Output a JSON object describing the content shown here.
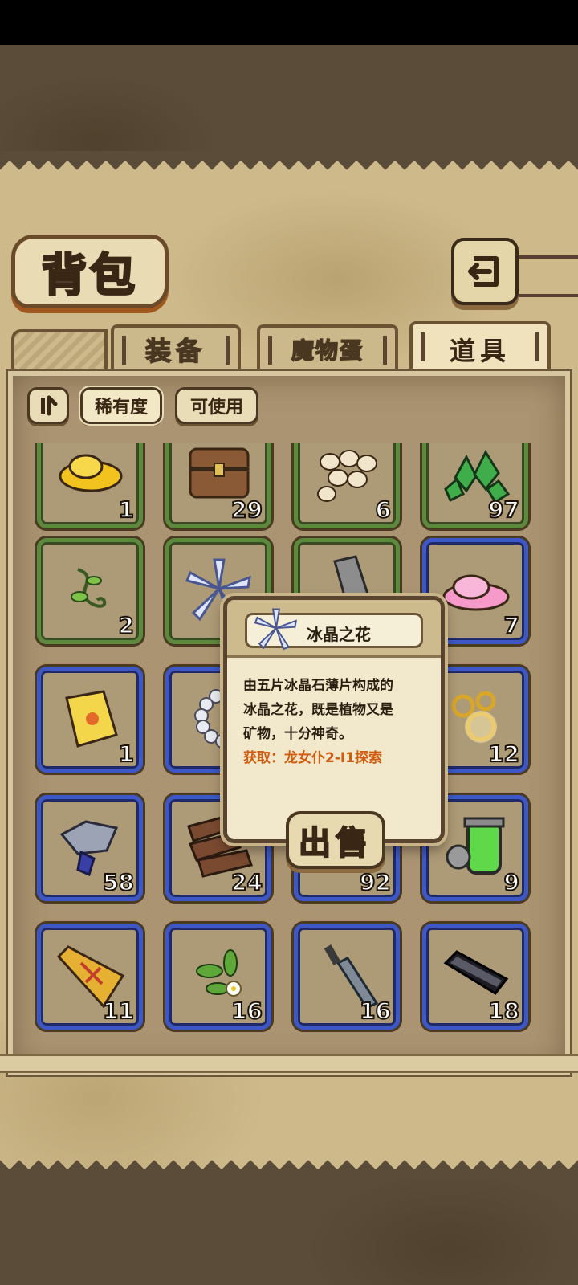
{
  "header": {
    "title": "背包",
    "back_icon": "back-arrow-icon"
  },
  "tabs": [
    {
      "label": "装备",
      "active": false
    },
    {
      "label": "魔物蛋",
      "active": false
    },
    {
      "label": "道具",
      "active": true
    }
  ],
  "filters": {
    "sort_icon": "sort-toggle-icon",
    "rarity_label": "稀有度",
    "usable_label": "可使用"
  },
  "items": [
    {
      "icon": "gold-slime-icon",
      "qty": "1",
      "rarity": "green"
    },
    {
      "icon": "treasure-chest-icon",
      "qty": "29",
      "rarity": "green"
    },
    {
      "icon": "eggs-pile-icon",
      "qty": "6",
      "rarity": "green"
    },
    {
      "icon": "green-crystals-icon",
      "qty": "97",
      "rarity": "green"
    },
    {
      "icon": "vine-icon",
      "qty": "2",
      "rarity": "green"
    },
    {
      "icon": "ice-crystal-flower-icon",
      "qty": "",
      "rarity": "green"
    },
    {
      "icon": "stone-shard-icon",
      "qty": "",
      "rarity": "green"
    },
    {
      "icon": "pink-slime-icon",
      "qty": "7",
      "rarity": "blue"
    },
    {
      "icon": "golden-scroll-icon",
      "qty": "1",
      "rarity": "blue"
    },
    {
      "icon": "pearl-necklace-icon",
      "qty": "",
      "rarity": "blue"
    },
    {
      "icon": "hidden-item-icon",
      "qty": "",
      "rarity": "blue"
    },
    {
      "icon": "golden-rings-icon",
      "qty": "12",
      "rarity": "blue"
    },
    {
      "icon": "fish-bone-icon",
      "qty": "58",
      "rarity": "blue"
    },
    {
      "icon": "wood-planks-icon",
      "qty": "24",
      "rarity": "blue"
    },
    {
      "icon": "hidden-item-icon",
      "qty": "92",
      "rarity": "blue"
    },
    {
      "icon": "green-potion-jar-icon",
      "qty": "9",
      "rarity": "blue"
    },
    {
      "icon": "gold-tag-icon",
      "qty": "11",
      "rarity": "blue"
    },
    {
      "icon": "flower-sprig-icon",
      "qty": "16",
      "rarity": "blue"
    },
    {
      "icon": "broken-sword-icon",
      "qty": "16",
      "rarity": "blue"
    },
    {
      "icon": "dark-blade-icon",
      "qty": "18",
      "rarity": "blue"
    }
  ],
  "tooltip": {
    "icon": "ice-crystal-flower-icon",
    "name": "冰晶之花",
    "description_1": "由五片冰晶石薄片构成的",
    "description_2": "冰晶之花，既是植物又是",
    "description_3": "矿物，十分神奇。",
    "source": "获取：龙女仆2-I1探索",
    "sell_label": "出售"
  },
  "colors": {
    "rarity_green": "#5b8a3c",
    "rarity_blue": "#3d57c4",
    "source_text": "#d05c10",
    "parchment": "#cdb98a"
  }
}
